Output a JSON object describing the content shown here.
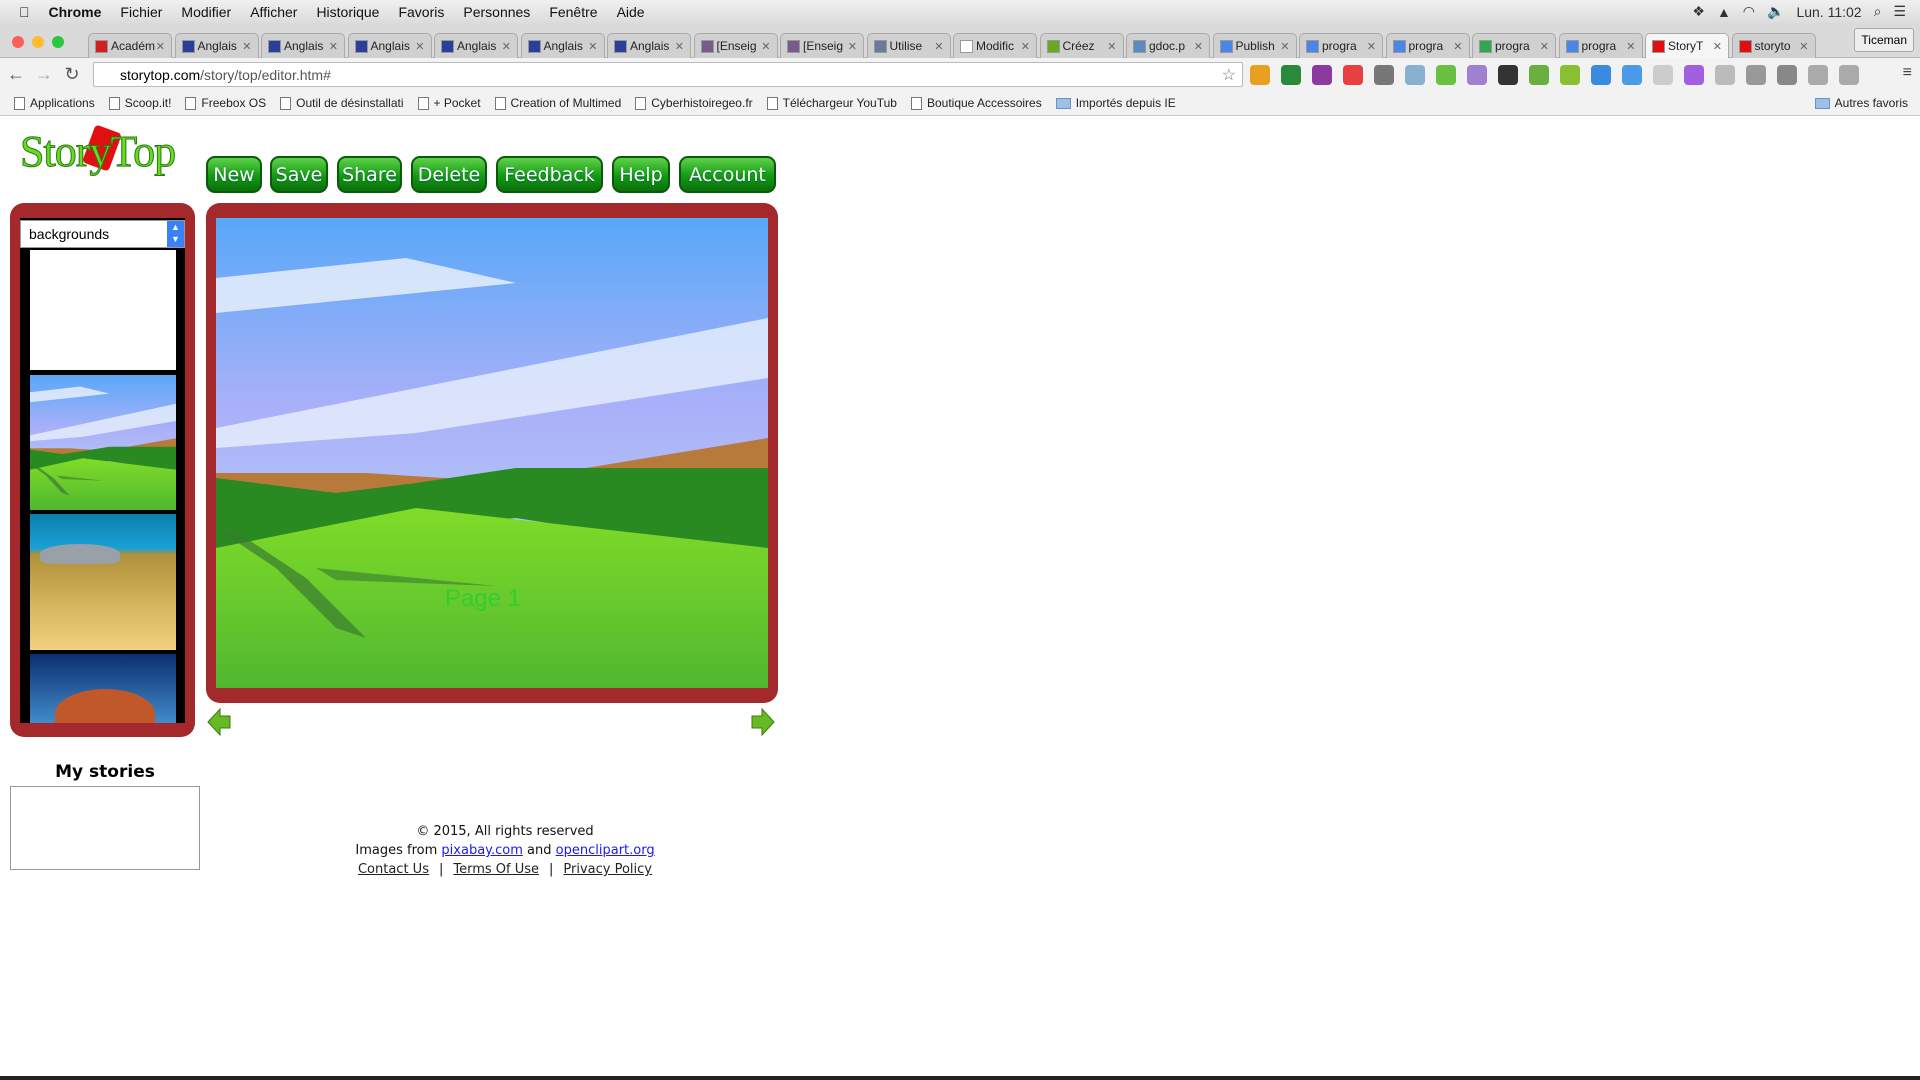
{
  "menubar": {
    "app": "Chrome",
    "items": [
      "Fichier",
      "Modifier",
      "Afficher",
      "Historique",
      "Favoris",
      "Personnes",
      "Fenêtre",
      "Aide"
    ],
    "clock": "Lun. 11:02"
  },
  "tabs": [
    {
      "label": "Académ",
      "color": "#d02020"
    },
    {
      "label": "Anglais",
      "color": "#2a3f9a"
    },
    {
      "label": "Anglais",
      "color": "#2a3f9a"
    },
    {
      "label": "Anglais",
      "color": "#2a3f9a"
    },
    {
      "label": "Anglais",
      "color": "#2a3f9a"
    },
    {
      "label": "Anglais",
      "color": "#2a3f9a"
    },
    {
      "label": "Anglais",
      "color": "#2a3f9a"
    },
    {
      "label": "[Enseig",
      "color": "#7a5a8a"
    },
    {
      "label": "[Enseig",
      "color": "#7a5a8a"
    },
    {
      "label": "Utilise",
      "color": "#6a7a9a"
    },
    {
      "label": "Modific",
      "color": "#ffffff"
    },
    {
      "label": "Créez",
      "color": "#66aa22"
    },
    {
      "label": "gdoc.p",
      "color": "#5a8ac2"
    },
    {
      "label": "Publish",
      "color": "#4a86e8"
    },
    {
      "label": "progra",
      "color": "#4a86e8"
    },
    {
      "label": "progra",
      "color": "#4a86e8"
    },
    {
      "label": "progra",
      "color": "#2fa84f"
    },
    {
      "label": "progra",
      "color": "#4a86e8"
    },
    {
      "label": "StoryT",
      "color": "#e01010",
      "active": true
    },
    {
      "label": "storyto",
      "color": "#e01010"
    }
  ],
  "profile": "Ticeman",
  "address": {
    "host": "storytop.com",
    "path": "/story/top/editor.htm#"
  },
  "bookmarks": [
    "Applications",
    "Scoop.it!",
    "Freebox OS",
    "Outil de désinstallati",
    "+ Pocket",
    "Creation of Multimed",
    "Cyberhistoiregeo.fr",
    "Téléchargeur YouTub",
    "Boutique Accessoires",
    "Importés depuis IE"
  ],
  "bookmarks_right": "Autres favoris",
  "app": {
    "logo": "StoryTop",
    "buttons": [
      "New",
      "Save",
      "Share",
      "Delete",
      "Feedback",
      "Help",
      "Account"
    ],
    "category_select": "backgrounds",
    "page_label": "Page 1",
    "my_stories": "My stories",
    "footer": {
      "copyright": "© 2015, All rights reserved",
      "images_from": "Images from",
      "and": "and",
      "link1": "pixabay.com",
      "link2": "openclipart.org",
      "contact": "Contact Us",
      "terms": "Terms Of Use",
      "privacy": "Privacy Policy"
    }
  },
  "colors": {
    "frame": "#a3292d",
    "button": "#129a12",
    "page_label": "#33cc33"
  }
}
